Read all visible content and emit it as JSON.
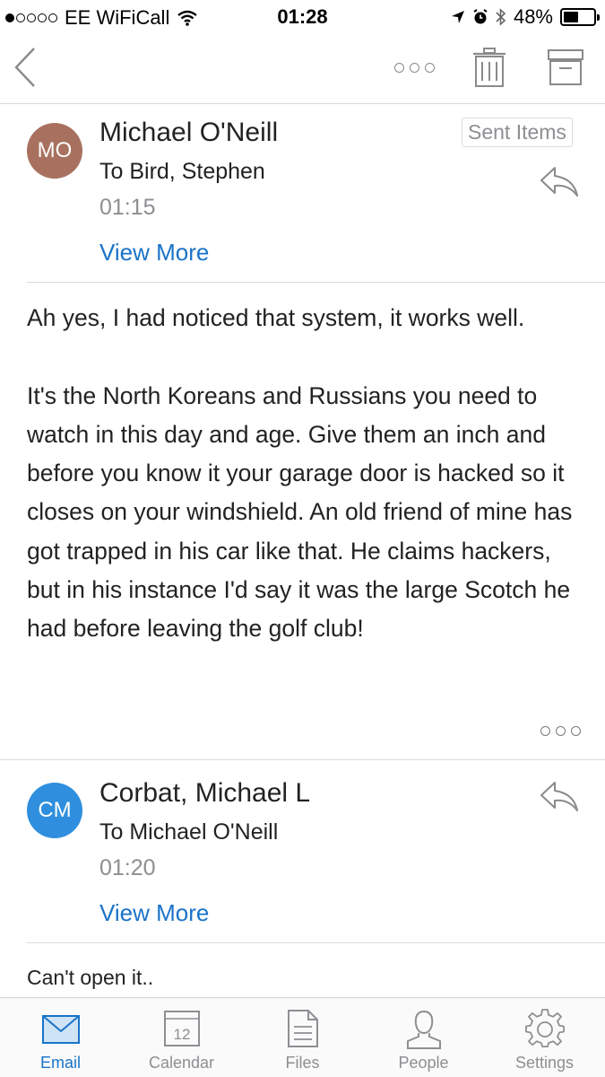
{
  "status_bar": {
    "carrier": "EE WiFiCall",
    "time": "01:28",
    "battery": "48%",
    "battery_level": 0.48,
    "signal_bars_filled": 1,
    "signal_bars_total": 5
  },
  "nav": {
    "back_icon": "chevron-left-icon",
    "more_icon": "more-dots-icon",
    "delete_icon": "trash-icon",
    "archive_icon": "archive-icon"
  },
  "messages": [
    {
      "initials": "MO",
      "avatar_color": "#a8715f",
      "sender": "Michael O'Neill",
      "recipient": "To Bird, Stephen",
      "time": "01:15",
      "view_more": "View More",
      "folder": "Sent Items",
      "body_paragraphs": [
        "Ah yes, I had noticed that system, it works well.",
        "It's the North Koreans and Russians you need to watch in this day and age. Give them an inch and before you know it your garage door is hacked so it closes on your windshield. An old friend of mine has got trapped in his car like that. He claims hackers, but in his instance I'd say it was the large Scotch he had before leaving the golf club!"
      ]
    },
    {
      "initials": "CM",
      "avatar_color": "#2f8fde",
      "sender": "Corbat, Michael L",
      "recipient": "To Michael O'Neill",
      "time": "01:20",
      "view_more": "View More",
      "body_paragraphs": [
        "Can't open it.."
      ]
    }
  ],
  "tabs": [
    {
      "label": "Email",
      "icon": "envelope-icon",
      "active": true
    },
    {
      "label": "Calendar",
      "icon": "calendar-icon",
      "day": "12",
      "active": false
    },
    {
      "label": "Files",
      "icon": "document-icon",
      "active": false
    },
    {
      "label": "People",
      "icon": "person-icon",
      "active": false
    },
    {
      "label": "Settings",
      "icon": "gear-icon",
      "active": false
    }
  ],
  "colors": {
    "accent": "#1a73c8",
    "muted": "#8e8e93",
    "divider": "#dcdcdc"
  }
}
